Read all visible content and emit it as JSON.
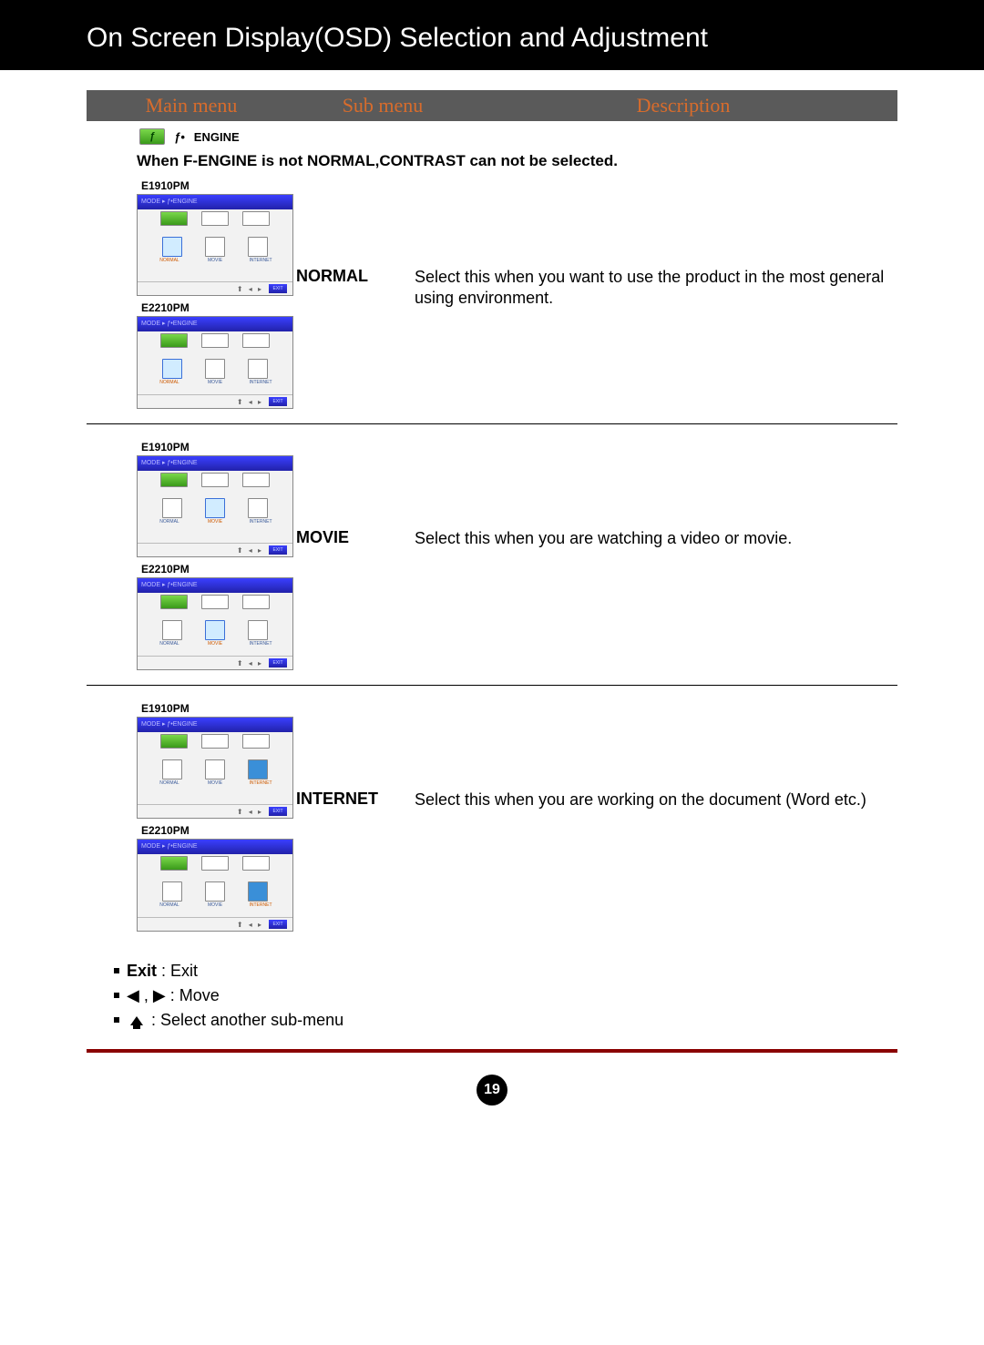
{
  "title": "On Screen Display(OSD) Selection and Adjustment",
  "table_header": {
    "main": "Main menu",
    "sub": "Sub menu",
    "desc": "Description"
  },
  "engine": {
    "label": "ENGINE",
    "prefix": "ƒ•",
    "badge": "ƒ"
  },
  "note": "When F-ENGINE is not NORMAL,CONTRAST can not be selected.",
  "models": {
    "a": "E1910PM",
    "b": "E2210PM"
  },
  "osd": {
    "breadcrumb": "MODE ▸ ƒ•ENGINE",
    "icons": [
      "NORMAL",
      "MOVIE",
      "INTERNET"
    ],
    "exit": "EXIT"
  },
  "rows": [
    {
      "sub": "NORMAL",
      "desc": "Select this when you want to use the product in the most general using environment.",
      "highlight": 0
    },
    {
      "sub": "MOVIE",
      "desc": "Select this when you are watching a video or movie.",
      "highlight": 1
    },
    {
      "sub": "INTERNET",
      "desc": "Select this when you are working on the document (Word etc.)",
      "highlight": 2
    }
  ],
  "legend": {
    "exit_bold": "Exit",
    "exit_desc": " : Exit",
    "move": " : Move",
    "arrows": "◀ , ▶",
    "select": " : Select another sub-menu"
  },
  "page_number": "19"
}
